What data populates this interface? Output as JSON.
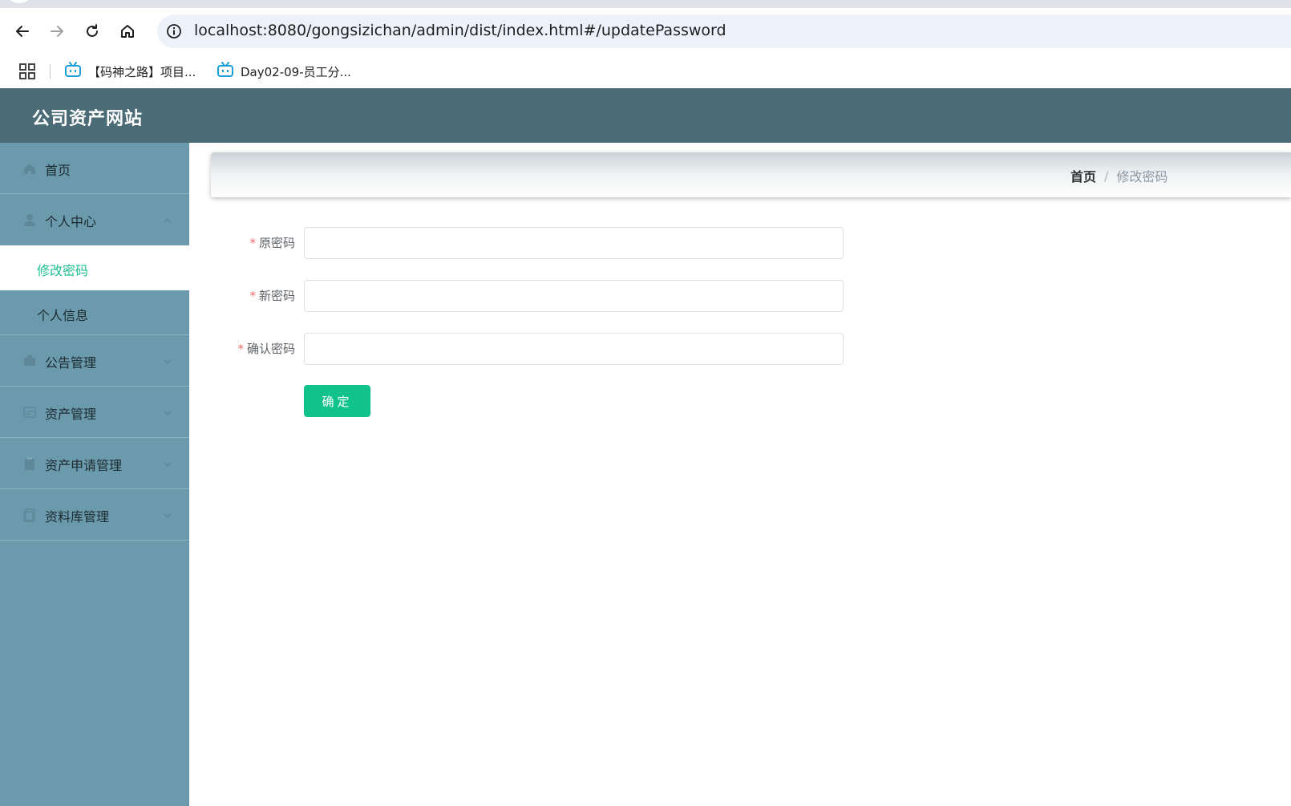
{
  "browser": {
    "url": "localhost:8080/gongsizichan/admin/dist/index.html#/updatePassword",
    "bookmarks": [
      {
        "label": "【码神之路】项目..."
      },
      {
        "label": "Day02-09-员工分..."
      }
    ]
  },
  "app": {
    "title": "公司资产网站"
  },
  "sidebar": {
    "items": [
      {
        "label": "首页",
        "icon": "home-icon"
      },
      {
        "label": "个人中心",
        "icon": "user-icon",
        "expanded": true,
        "children": [
          {
            "label": "修改密码",
            "active": true
          },
          {
            "label": "个人信息",
            "active": false
          }
        ]
      },
      {
        "label": "公告管理",
        "icon": "notice-icon"
      },
      {
        "label": "资产管理",
        "icon": "asset-icon"
      },
      {
        "label": "资产申请管理",
        "icon": "clipboard-icon"
      },
      {
        "label": "资料库管理",
        "icon": "document-icon"
      }
    ]
  },
  "breadcrumb": {
    "home": "首页",
    "separator": "/",
    "current": "修改密码"
  },
  "form": {
    "required_mark": "*",
    "fields": [
      {
        "label": "原密码",
        "value": ""
      },
      {
        "label": "新密码",
        "value": ""
      },
      {
        "label": "确认密码",
        "value": ""
      }
    ],
    "submit_label": "确定"
  },
  "colors": {
    "header_bg": "#4b6b76",
    "sidebar_bg": "#6a9aac",
    "accent": "#11c28b",
    "active_text": "#1fbf8f",
    "required": "#f56c6c"
  }
}
